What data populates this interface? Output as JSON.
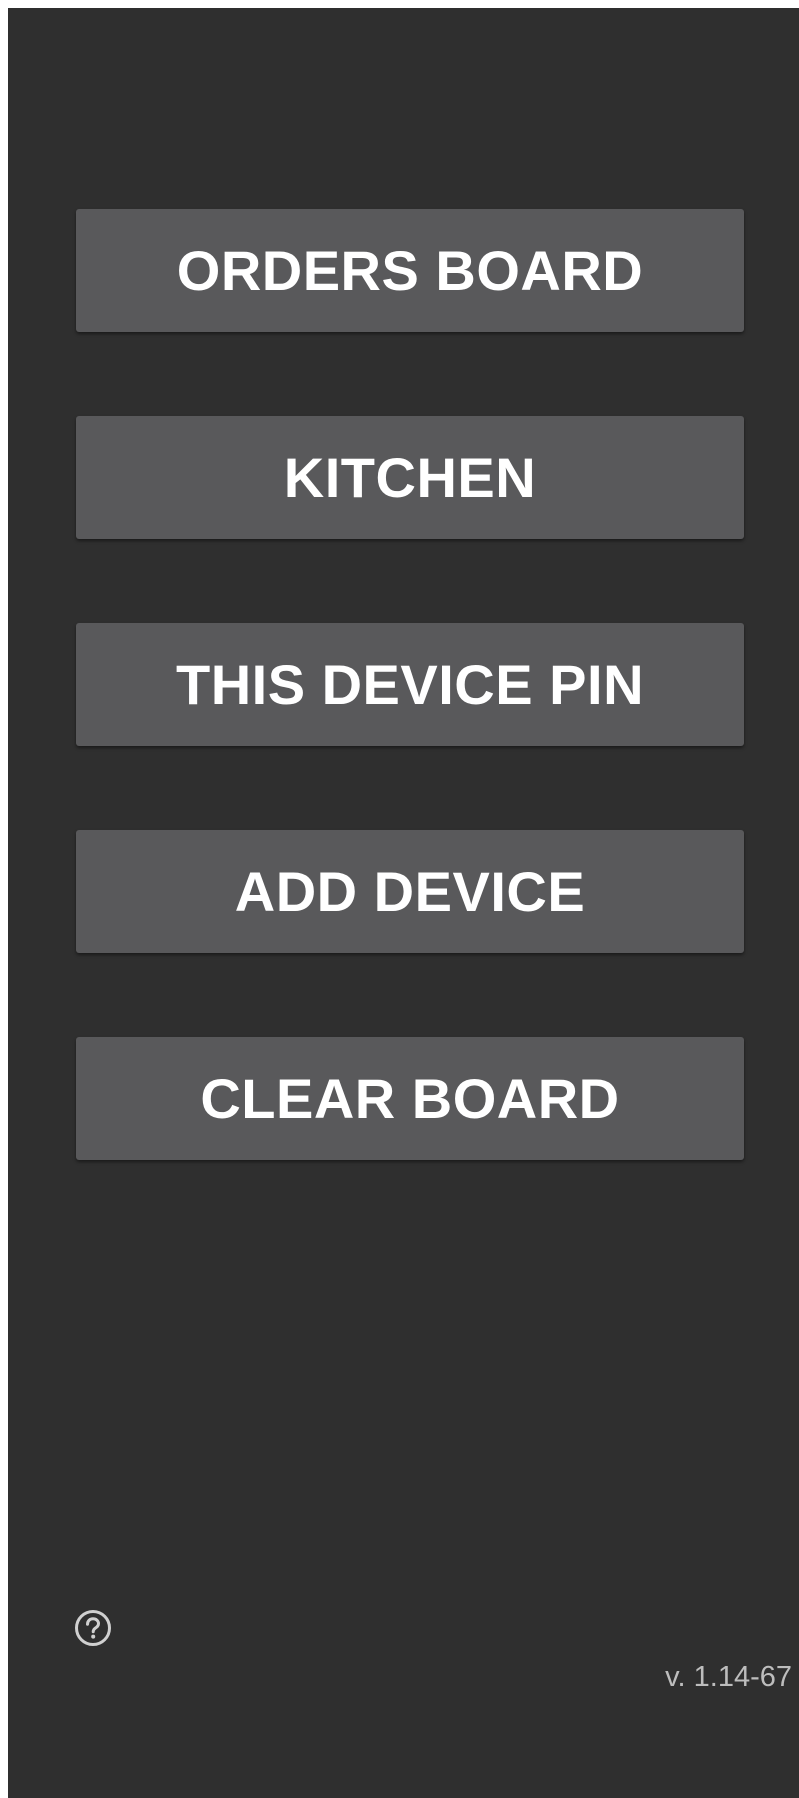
{
  "menu": {
    "buttons": [
      {
        "label": "ORDERS BOARD"
      },
      {
        "label": "KITCHEN"
      },
      {
        "label": "THIS DEVICE PIN"
      },
      {
        "label": "ADD DEVICE"
      },
      {
        "label": "CLEAR BOARD"
      }
    ]
  },
  "footer": {
    "help_icon": "help-circle-icon",
    "version": "v. 1.14-67"
  },
  "colors": {
    "background": "#2f2f2f",
    "button": "#59595b",
    "button_text": "#ffffff",
    "version_text": "#bdbdbd"
  }
}
